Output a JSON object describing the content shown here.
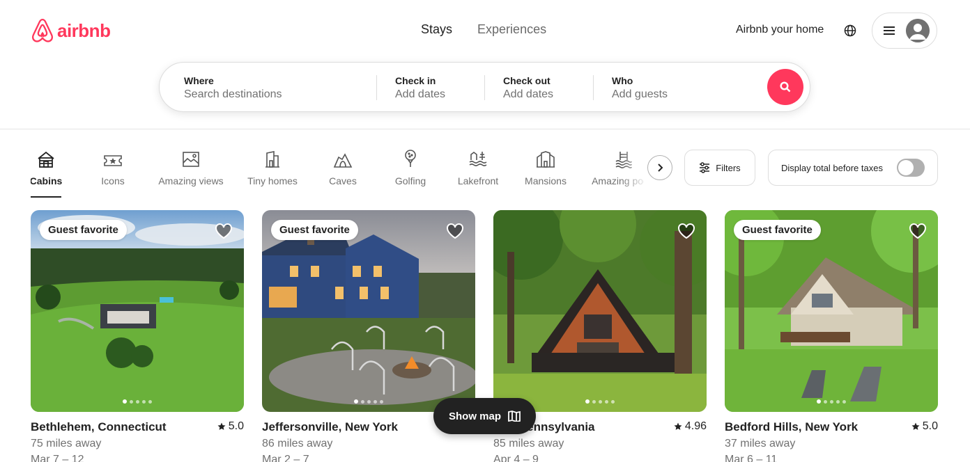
{
  "brand": {
    "name": "airbnb",
    "color": "#ff385c"
  },
  "topnav": {
    "stays": "Stays",
    "experiences": "Experiences"
  },
  "header": {
    "host_link": "Airbnb your home",
    "globe_icon": "globe-icon",
    "menu_icon": "hamburger-icon",
    "avatar_icon": "user-avatar-icon"
  },
  "search": {
    "where": {
      "label": "Where",
      "placeholder": "Search destinations"
    },
    "checkin": {
      "label": "Check in",
      "placeholder": "Add dates"
    },
    "checkout": {
      "label": "Check out",
      "placeholder": "Add dates"
    },
    "who": {
      "label": "Who",
      "placeholder": "Add guests"
    },
    "button_icon": "search-icon"
  },
  "categories": [
    {
      "label": "Cabins",
      "icon": "cabin-icon",
      "active": true
    },
    {
      "label": "Icons",
      "icon": "ticket-icon"
    },
    {
      "label": "Amazing views",
      "icon": "landscape-icon"
    },
    {
      "label": "Tiny homes",
      "icon": "tiny-home-icon"
    },
    {
      "label": "Caves",
      "icon": "cave-icon"
    },
    {
      "label": "Golfing",
      "icon": "golf-icon"
    },
    {
      "label": "Lakefront",
      "icon": "lakefront-icon"
    },
    {
      "label": "Mansions",
      "icon": "mansion-icon"
    },
    {
      "label": "Amazing pools",
      "icon": "pool-icon"
    }
  ],
  "controls": {
    "filters": "Filters",
    "taxes_toggle": "Display total before taxes",
    "taxes_on": false
  },
  "listings": [
    {
      "badge": "Guest favorite",
      "title": "Bethlehem, Connecticut",
      "rating": "5.0",
      "distance": "75 miles away",
      "dates": "Mar 7 – 12"
    },
    {
      "badge": "Guest favorite",
      "title": "Jeffersonville, New York",
      "rating": "",
      "distance": "86 miles away",
      "dates": "Mar 2 – 7"
    },
    {
      "badge": "",
      "title": "…n, Pennsylvania",
      "rating": "4.96",
      "distance": "85 miles away",
      "dates": "Apr 4 – 9"
    },
    {
      "badge": "Guest favorite",
      "title": "Bedford Hills, New York",
      "rating": "5.0",
      "distance": "37 miles away",
      "dates": "Mar 6 – 11"
    }
  ],
  "show_map": {
    "label": "Show map",
    "icon": "map-icon"
  }
}
